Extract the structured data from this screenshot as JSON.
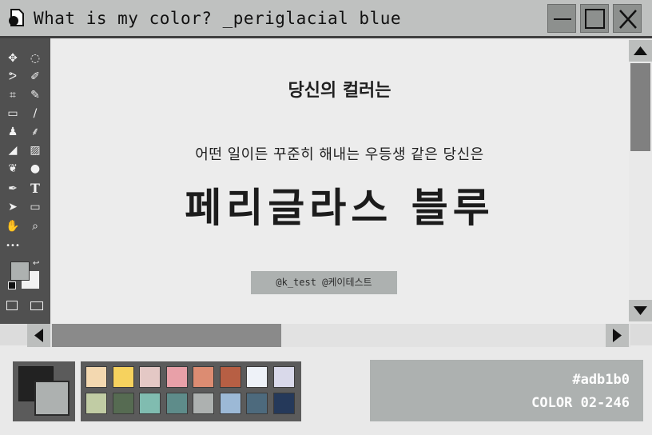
{
  "window": {
    "title": "What is my color? _periglacial blue",
    "controls": {
      "minimize_icon": "minimize-icon",
      "maximize_icon": "maximize-icon",
      "close_icon": "close-icon"
    }
  },
  "toolbar": {
    "tools": [
      {
        "icon": "move-icon",
        "glyph": "✥"
      },
      {
        "icon": "ellipse-select-icon",
        "glyph": "◌"
      },
      {
        "icon": "lasso-icon",
        "glyph": "ᕗ"
      },
      {
        "icon": "quick-select-icon",
        "glyph": "✐"
      },
      {
        "icon": "crop-icon",
        "glyph": "⌗"
      },
      {
        "icon": "eyedropper-icon",
        "glyph": "✎"
      },
      {
        "icon": "healing-icon",
        "glyph": "▭"
      },
      {
        "icon": "brush-icon",
        "glyph": "/"
      },
      {
        "icon": "stamp-icon",
        "glyph": "♟"
      },
      {
        "icon": "history-brush-icon",
        "glyph": "⸙"
      },
      {
        "icon": "eraser-icon",
        "glyph": "◢"
      },
      {
        "icon": "gradient-icon",
        "glyph": "▨"
      },
      {
        "icon": "smudge-icon",
        "glyph": "❦"
      },
      {
        "icon": "dodge-icon",
        "glyph": "●"
      },
      {
        "icon": "pen-icon",
        "glyph": "✒"
      },
      {
        "icon": "type-icon",
        "glyph": "T"
      },
      {
        "icon": "path-select-icon",
        "glyph": "➤"
      },
      {
        "icon": "rectangle-icon",
        "glyph": "▭"
      },
      {
        "icon": "hand-icon",
        "glyph": "✋"
      },
      {
        "icon": "zoom-icon",
        "glyph": "⌕"
      },
      {
        "icon": "more-tools-icon",
        "glyph": "•••"
      }
    ],
    "foreground_color": "#adb1b0",
    "background_color": "#f2f2f2"
  },
  "canvas": {
    "subtitle": "당신의 컬러는",
    "description": "어떤 일이든 꾸준히 해내는 우등생 같은 당신은",
    "color_name": "페리글라스 블루",
    "credit": "@k_test @케이테스트"
  },
  "palette": {
    "foreground": "#222222",
    "background": "#adb1b0",
    "swatches": [
      "#f3d8b0",
      "#f6d25e",
      "#e4c8c5",
      "#e8a0a8",
      "#dc8c72",
      "#b75f44",
      "#eef2f8",
      "#d9d9ea",
      "#c1cca4",
      "#566b52",
      "#80bcb0",
      "#5e8c8a",
      "#adb1b0",
      "#9cb9d6",
      "#4d6a7d",
      "#25395a"
    ]
  },
  "info": {
    "hex": "#adb1b0",
    "code": "COLOR 02-246"
  }
}
